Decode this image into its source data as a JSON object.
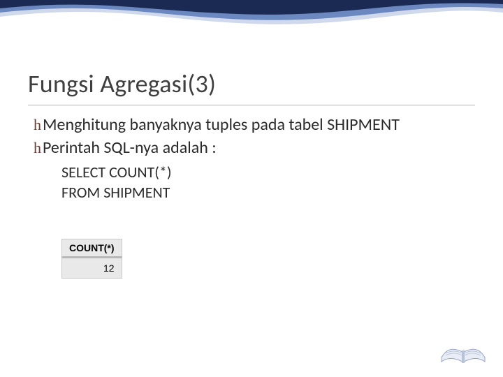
{
  "title": "Fungsi Agregasi(3)",
  "bullets": [
    "Menghitung banyaknya tuples pada tabel SHIPMENT",
    "Perintah SQL-nya adalah :"
  ],
  "sql": {
    "line1": "SELECT COUNT(*)",
    "line2": "FROM SHIPMENT"
  },
  "result": {
    "header": "COUNT(*)",
    "value": "12"
  },
  "icons": {
    "bullet_glyph": "h"
  },
  "colors": {
    "wave_dark": "#1b2a52",
    "wave_mid": "#6b88c0",
    "wave_light": "#cfd9eb",
    "bullet_color": "#6e3d2f"
  }
}
